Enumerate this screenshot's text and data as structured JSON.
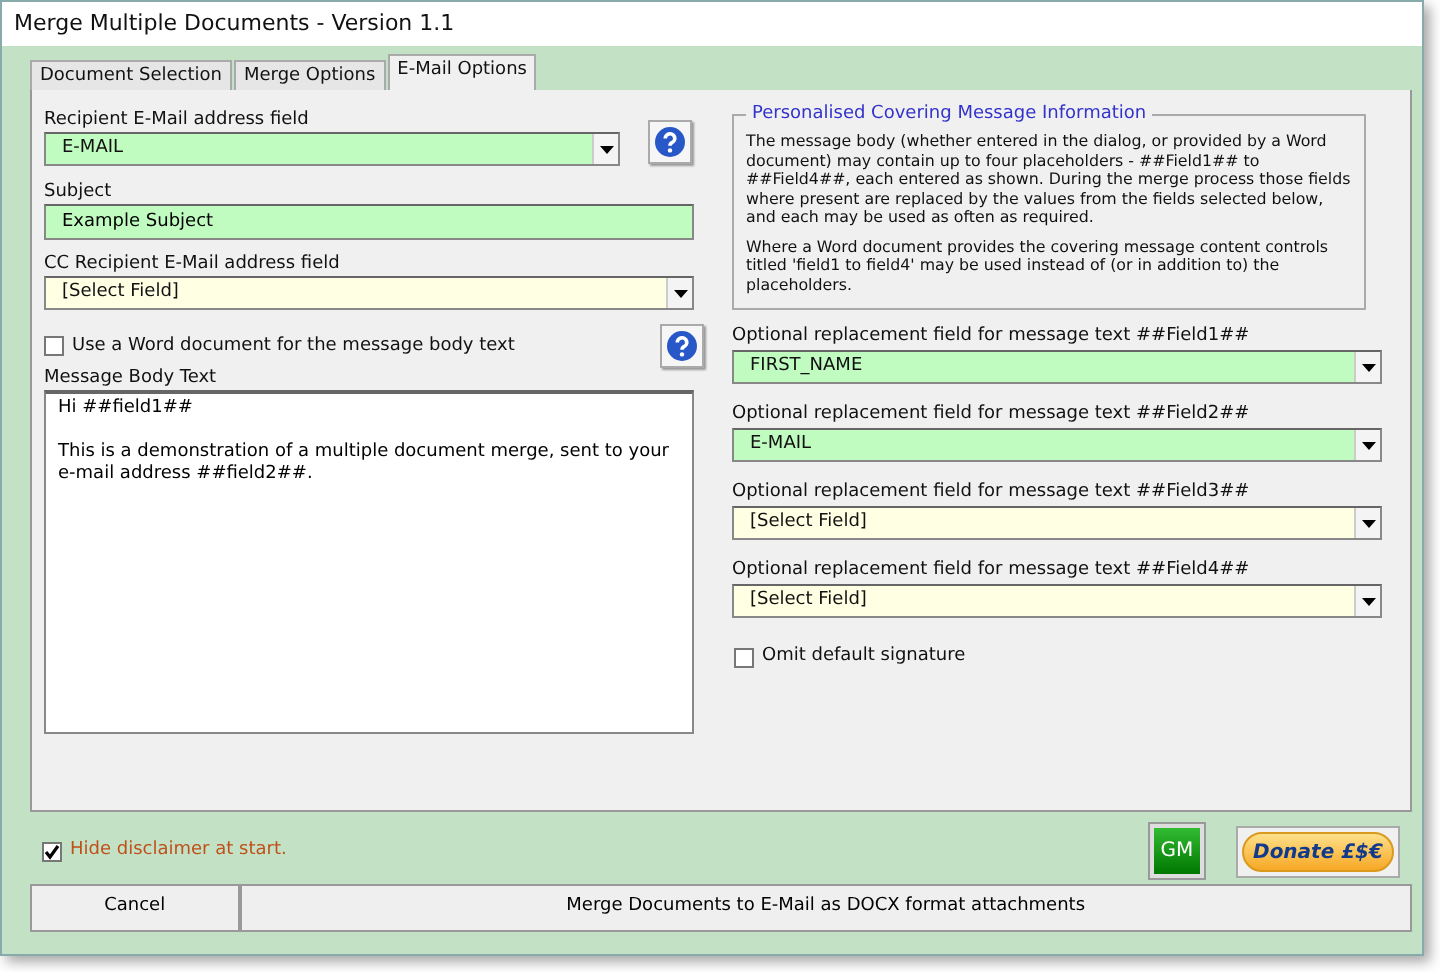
{
  "window": {
    "title": "Merge Multiple Documents - Version 1.1"
  },
  "tabs": [
    {
      "label": "Document Selection",
      "selected": false
    },
    {
      "label": "Merge Options",
      "selected": false
    },
    {
      "label": "E-Mail Options",
      "selected": true
    }
  ],
  "left": {
    "recipient": {
      "label": "Recipient E-Mail address field",
      "value": "E-MAIL",
      "highlighted": true
    },
    "subject": {
      "label": "Subject",
      "value": "Example Subject",
      "highlighted": true
    },
    "cc": {
      "label": "CC Recipient E-Mail address field",
      "value": "[Select Field]",
      "highlighted": false
    },
    "use_word_document": {
      "label": "Use a Word document for the message body text",
      "checked": false
    },
    "message_body": {
      "label": "Message Body Text",
      "value": "Hi ##field1##\n\nThis is a demonstration of a multiple document merge, sent to your e-mail address ##field2##."
    }
  },
  "right": {
    "info": {
      "title": "Personalised Covering Message Information",
      "paragraphs": [
        "The message body (whether entered in the dialog, or provided by a Word document) may contain up to four placeholders - ##Field1## to ##Field4##, each entered as shown. During the merge process those fields where present are replaced by the values from the fields selected below, and each may be used as often as required.",
        "Where a Word document provides the covering message content controls titled 'field1 to field4' may be used instead of (or in addition to) the placeholders."
      ]
    },
    "replacement_fields": [
      {
        "label": "Optional replacement field for message text ##Field1##",
        "value": "FIRST_NAME",
        "highlighted": true
      },
      {
        "label": "Optional replacement field for message text ##Field2##",
        "value": "E-MAIL",
        "highlighted": true
      },
      {
        "label": "Optional replacement field for message text ##Field3##",
        "value": "[Select Field]",
        "highlighted": false
      },
      {
        "label": "Optional replacement field for message text ##Field4##",
        "value": "[Select Field]",
        "highlighted": false
      }
    ],
    "omit_signature": {
      "label": "Omit default signature",
      "checked": false
    }
  },
  "footer": {
    "hide_disclaimer": {
      "label": "Hide disclaimer at start.",
      "checked": true
    },
    "gm_button": "GM",
    "donate_button": "Donate £$€",
    "buttons": [
      "Cancel",
      "Merge Documents to E-Mail as DOCX format attachments"
    ]
  }
}
